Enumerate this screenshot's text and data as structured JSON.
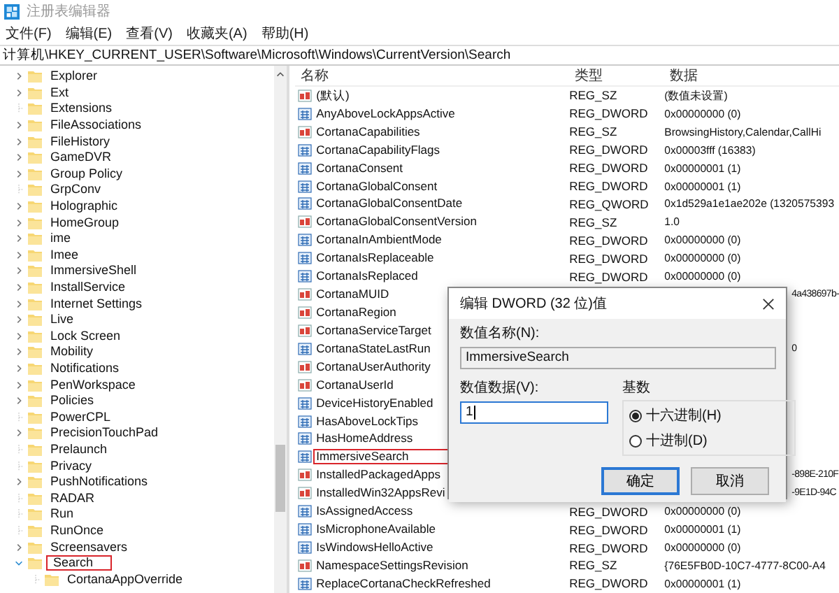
{
  "window": {
    "title": "注册表编辑器"
  },
  "menu": [
    "文件(F)",
    "编辑(E)",
    "查看(V)",
    "收藏夹(A)",
    "帮助(H)"
  ],
  "address": "计算机\\HKEY_CURRENT_USER\\Software\\Microsoft\\Windows\\CurrentVersion\\Search",
  "tree": [
    {
      "label": "Explorer",
      "expandable": true,
      "expanded": false,
      "highlighted": false
    },
    {
      "label": "Ext",
      "expandable": true,
      "expanded": false,
      "highlighted": false
    },
    {
      "label": "Extensions",
      "expandable": false,
      "highlighted": false
    },
    {
      "label": "FileAssociations",
      "expandable": true,
      "expanded": false,
      "highlighted": false
    },
    {
      "label": "FileHistory",
      "expandable": true,
      "expanded": false,
      "highlighted": false
    },
    {
      "label": "GameDVR",
      "expandable": true,
      "expanded": false,
      "highlighted": false
    },
    {
      "label": "Group Policy",
      "expandable": true,
      "expanded": false,
      "highlighted": false
    },
    {
      "label": "GrpConv",
      "expandable": false,
      "highlighted": false
    },
    {
      "label": "Holographic",
      "expandable": true,
      "expanded": false,
      "highlighted": false
    },
    {
      "label": "HomeGroup",
      "expandable": true,
      "expanded": false,
      "highlighted": false
    },
    {
      "label": "ime",
      "expandable": true,
      "expanded": false,
      "highlighted": false
    },
    {
      "label": "Imee",
      "expandable": true,
      "expanded": false,
      "highlighted": false
    },
    {
      "label": "ImmersiveShell",
      "expandable": true,
      "expanded": false,
      "highlighted": false
    },
    {
      "label": "InstallService",
      "expandable": true,
      "expanded": false,
      "highlighted": false
    },
    {
      "label": "Internet Settings",
      "expandable": true,
      "expanded": false,
      "highlighted": false
    },
    {
      "label": "Live",
      "expandable": true,
      "expanded": false,
      "highlighted": false
    },
    {
      "label": "Lock Screen",
      "expandable": true,
      "expanded": false,
      "highlighted": false
    },
    {
      "label": "Mobility",
      "expandable": true,
      "expanded": false,
      "highlighted": false
    },
    {
      "label": "Notifications",
      "expandable": true,
      "expanded": false,
      "highlighted": false
    },
    {
      "label": "PenWorkspace",
      "expandable": true,
      "expanded": false,
      "highlighted": false
    },
    {
      "label": "Policies",
      "expandable": true,
      "expanded": false,
      "highlighted": false
    },
    {
      "label": "PowerCPL",
      "expandable": false,
      "highlighted": false
    },
    {
      "label": "PrecisionTouchPad",
      "expandable": true,
      "expanded": false,
      "highlighted": false
    },
    {
      "label": "Prelaunch",
      "expandable": false,
      "highlighted": false
    },
    {
      "label": "Privacy",
      "expandable": false,
      "highlighted": false
    },
    {
      "label": "PushNotifications",
      "expandable": true,
      "expanded": false,
      "highlighted": false
    },
    {
      "label": "RADAR",
      "expandable": false,
      "highlighted": false
    },
    {
      "label": "Run",
      "expandable": false,
      "highlighted": false
    },
    {
      "label": "RunOnce",
      "expandable": false,
      "highlighted": false
    },
    {
      "label": "Screensavers",
      "expandable": true,
      "expanded": false,
      "highlighted": false
    },
    {
      "label": "Search",
      "expandable": true,
      "expanded": true,
      "highlighted": true,
      "children": [
        {
          "label": "CortanaAppOverride",
          "expandable": false,
          "highlighted": false
        }
      ]
    }
  ],
  "columns": [
    "名称",
    "类型",
    "数据"
  ],
  "values": [
    {
      "kind": "string",
      "name": "(默认)",
      "type": "REG_SZ",
      "data": "(数值未设置)",
      "highlighted": false
    },
    {
      "kind": "binary",
      "name": "AnyAboveLockAppsActive",
      "type": "REG_DWORD",
      "data": "0x00000000 (0)",
      "highlighted": false
    },
    {
      "kind": "string",
      "name": "CortanaCapabilities",
      "type": "REG_SZ",
      "data": "BrowsingHistory,Calendar,CallHi",
      "highlighted": false
    },
    {
      "kind": "binary",
      "name": "CortanaCapabilityFlags",
      "type": "REG_DWORD",
      "data": "0x00003fff (16383)",
      "highlighted": false
    },
    {
      "kind": "binary",
      "name": "CortanaConsent",
      "type": "REG_DWORD",
      "data": "0x00000001 (1)",
      "highlighted": false
    },
    {
      "kind": "binary",
      "name": "CortanaGlobalConsent",
      "type": "REG_DWORD",
      "data": "0x00000001 (1)",
      "highlighted": false
    },
    {
      "kind": "binary",
      "name": "CortanaGlobalConsentDate",
      "type": "REG_QWORD",
      "data": "0x1d529a1e1ae202e (1320575393",
      "highlighted": false
    },
    {
      "kind": "string",
      "name": "CortanaGlobalConsentVersion",
      "type": "REG_SZ",
      "data": "1.0",
      "highlighted": false
    },
    {
      "kind": "binary",
      "name": "CortanaInAmbientMode",
      "type": "REG_DWORD",
      "data": "0x00000000 (0)",
      "highlighted": false
    },
    {
      "kind": "binary",
      "name": "CortanaIsReplaceable",
      "type": "REG_DWORD",
      "data": "0x00000000 (0)",
      "highlighted": false
    },
    {
      "kind": "binary",
      "name": "CortanaIsReplaced",
      "type": "REG_DWORD",
      "data": "0x00000000 (0)",
      "highlighted": false
    },
    {
      "kind": "string",
      "name": "CortanaMUID",
      "data_fragment": "4a438697b-",
      "highlighted": false
    },
    {
      "kind": "string",
      "name": "CortanaRegion",
      "highlighted": false
    },
    {
      "kind": "string",
      "name": "CortanaServiceTarget",
      "highlighted": false
    },
    {
      "kind": "binary",
      "name": "CortanaStateLastRun",
      "data_fragment": "0",
      "highlighted": false
    },
    {
      "kind": "string",
      "name": "CortanaUserAuthority",
      "highlighted": false
    },
    {
      "kind": "string",
      "name": "CortanaUserId",
      "highlighted": false
    },
    {
      "kind": "binary",
      "name": "DeviceHistoryEnabled",
      "highlighted": false
    },
    {
      "kind": "binary",
      "name": "HasAboveLockTips",
      "highlighted": false
    },
    {
      "kind": "binary",
      "name": "HasHomeAddress",
      "highlighted": false
    },
    {
      "kind": "binary",
      "name": "ImmersiveSearch",
      "highlighted": true
    },
    {
      "kind": "string",
      "name": "InstalledPackagedApps",
      "data_fragment": "-898E-210F",
      "highlighted": false
    },
    {
      "kind": "string",
      "name": "InstalledWin32AppsRevi",
      "data_fragment": "-9E1D-94C",
      "highlighted": false
    },
    {
      "kind": "binary",
      "name": "IsAssignedAccess",
      "type": "REG_DWORD",
      "data": "0x00000000 (0)",
      "highlighted": false
    },
    {
      "kind": "binary",
      "name": "IsMicrophoneAvailable",
      "type": "REG_DWORD",
      "data": "0x00000001 (1)",
      "highlighted": false
    },
    {
      "kind": "binary",
      "name": "IsWindowsHelloActive",
      "type": "REG_DWORD",
      "data": "0x00000000 (0)",
      "highlighted": false
    },
    {
      "kind": "string",
      "name": "NamespaceSettingsRevision",
      "type": "REG_SZ",
      "data": "{76E5FB0D-10C7-4777-8C00-A4",
      "highlighted": false
    },
    {
      "kind": "binary",
      "name": "ReplaceCortanaCheckRefreshed",
      "type": "REG_DWORD",
      "data": "0x00000001 (1)",
      "highlighted": false
    }
  ],
  "dialog": {
    "title": "编辑 DWORD (32 位)值",
    "name_label": "数值名称(N):",
    "name_value": "ImmersiveSearch",
    "data_label": "数值数据(V):",
    "data_value": "1",
    "base_label": "基数",
    "bases": [
      {
        "label": "十六进制(H)",
        "selected": true
      },
      {
        "label": "十进制(D)",
        "selected": false
      }
    ],
    "buttons": [
      {
        "label": "确定",
        "default": true
      },
      {
        "label": "取消",
        "default": false
      }
    ]
  }
}
